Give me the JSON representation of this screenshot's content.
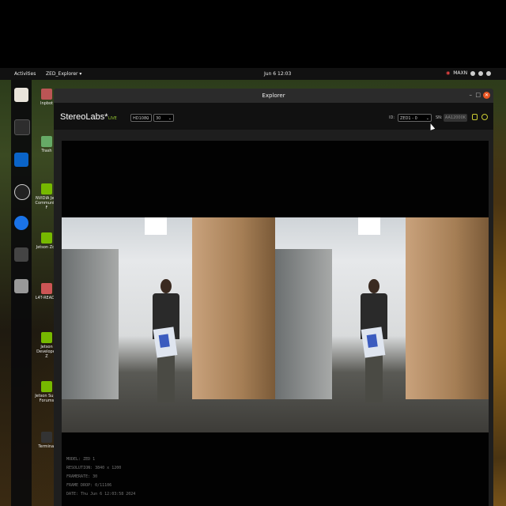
{
  "topbar": {
    "activities": "Activities",
    "app_menu": "ZED_Explorer ▾",
    "clock": "Jun 6 12:03",
    "power_mode": "MAXN"
  },
  "desktop_icons": [
    {
      "label": "Inpbot"
    },
    {
      "label": "Trash"
    },
    {
      "label": "NVIDIA Jets Community F"
    },
    {
      "label": "Jetson Zoo"
    },
    {
      "label": "L4T-READM"
    },
    {
      "label": "Jetson Developer Z"
    },
    {
      "label": "Jetson Supp Forums"
    },
    {
      "label": "Terminal"
    }
  ],
  "window": {
    "title": "Explorer",
    "minimize": "–",
    "maximize": "□",
    "close": "✕"
  },
  "appbar": {
    "brand": "StereoLabs*",
    "live_label": "LIVE",
    "resolution_select": "HD1080",
    "fps_select": "30",
    "id_label": "ID:",
    "camera_select": "ZED1 - 0",
    "sn_label": "SN:",
    "sn_placeholder": "AA12000K"
  },
  "info": {
    "model": "MODEL: ZED 1",
    "resolution": "RESOLUTION: 3840 x 1200",
    "framerate": "FRAMERATE: 30",
    "frame_drop": "FRAME DROP: 0/11106",
    "date": "DATE: Thu Jun 6 12:03:58 2024"
  },
  "colors": {
    "accent_close": "#e95420",
    "live": "#99cc33",
    "icon_yellow": "#cccc33"
  }
}
